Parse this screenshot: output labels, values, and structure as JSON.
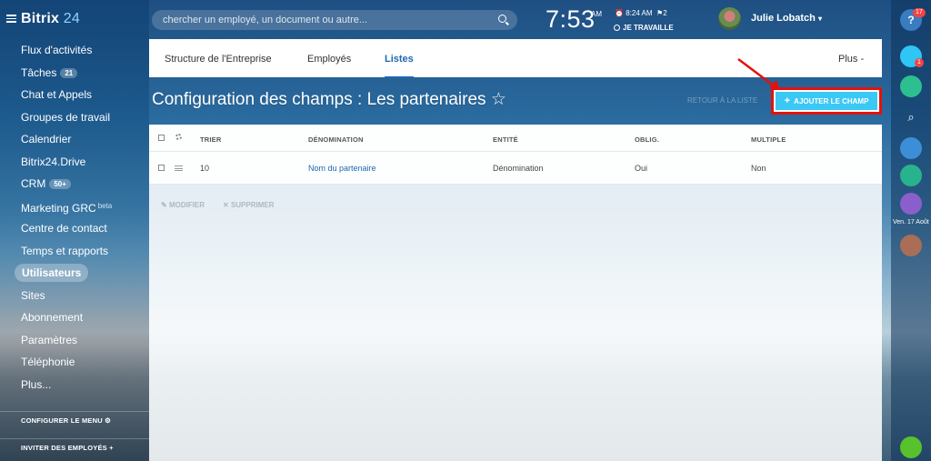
{
  "app": {
    "logo_main": "Bitrix",
    "logo_suffix": "24"
  },
  "sidebar": {
    "items": [
      {
        "label": "Flux d'activités"
      },
      {
        "label": "Tâches",
        "badge": "21"
      },
      {
        "label": "Chat et Appels"
      },
      {
        "label": "Groupes de travail"
      },
      {
        "label": "Calendrier"
      },
      {
        "label": "Bitrix24.Drive"
      },
      {
        "label": "CRM",
        "badge": "50+"
      },
      {
        "label": "Marketing GRC",
        "sup": "beta"
      },
      {
        "label": "Centre de contact"
      },
      {
        "label": "Temps et rapports"
      },
      {
        "label": "Utilisateurs"
      },
      {
        "label": "Sites"
      },
      {
        "label": "Abonnement"
      },
      {
        "label": "Paramètres"
      },
      {
        "label": "Téléphonie"
      },
      {
        "label": "Plus..."
      }
    ],
    "configure": "CONFIGURER LE MENU",
    "invite": "INVITER DES EMPLOYÉS"
  },
  "header": {
    "search_placeholder": "chercher un employé, un document ou autre...",
    "clock": "7:53",
    "ampm": "AM",
    "time_small": "8:24 AM",
    "count": "2",
    "status": "JE TRAVAILLE",
    "user": "Julie Lobatch"
  },
  "tabs": [
    {
      "label": "Structure de l'Entreprise"
    },
    {
      "label": "Employés"
    },
    {
      "label": "Listes"
    }
  ],
  "more": "Plus",
  "page": {
    "title": "Configuration des champs : Les partenaires ☆",
    "dim_label": "RETOUR À LA LISTE",
    "add_button": "AJOUTER LE CHAMP"
  },
  "table": {
    "headers": {
      "sort": "TRIER",
      "name": "DÉNOMINATION",
      "entity": "ENTITÉ",
      "required": "OBLIG.",
      "multiple": "MULTIPLE"
    },
    "rows": [
      {
        "sort": "10",
        "name": "Nom du partenaire",
        "entity": "Dénomination",
        "required": "Oui",
        "multiple": "Non"
      }
    ],
    "actions": {
      "edit": "MODIFIER",
      "delete": "SUPPRIMER"
    }
  },
  "rightbar": {
    "help_badge": "17",
    "notif_badge": "1",
    "date": "Ven. 17 Août"
  },
  "colors": {
    "accent": "#3bc8f5",
    "highlight": "#e3120b",
    "link": "#2067b0"
  }
}
